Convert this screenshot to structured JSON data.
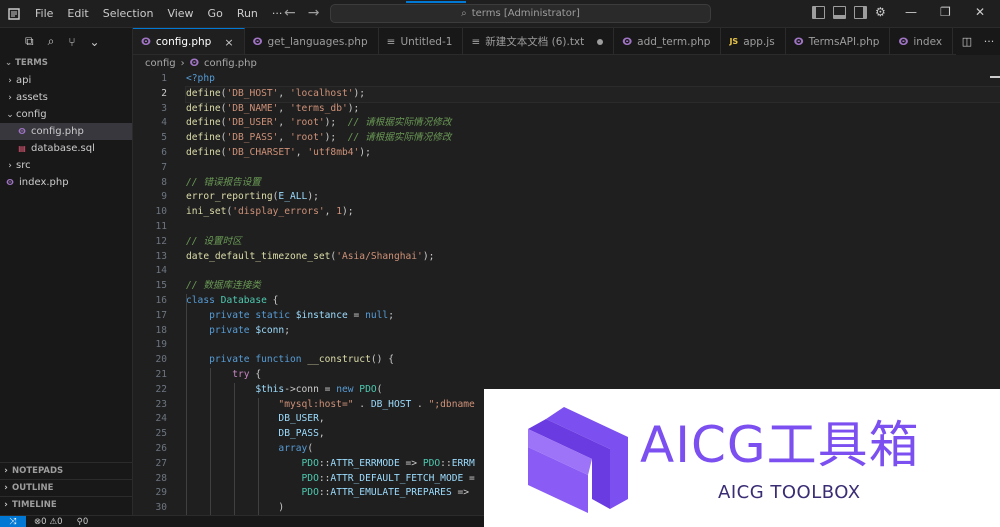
{
  "menu": [
    "File",
    "Edit",
    "Selection",
    "View",
    "Go",
    "Run",
    "···"
  ],
  "command_center": "terms [Administrator]",
  "sidebar": {
    "section": "TERMS",
    "tree": [
      {
        "name": "api",
        "type": "folder",
        "depth": 0
      },
      {
        "name": "assets",
        "type": "folder",
        "depth": 0
      },
      {
        "name": "config",
        "type": "folder-open",
        "depth": 0
      },
      {
        "name": "config.php",
        "type": "php",
        "depth": 1,
        "active": true
      },
      {
        "name": "database.sql",
        "type": "sql",
        "depth": 1
      },
      {
        "name": "src",
        "type": "folder",
        "depth": 0
      },
      {
        "name": "index.php",
        "type": "php",
        "depth": 0
      }
    ],
    "bottom": [
      "NOTEPADS",
      "OUTLINE",
      "TIMELINE"
    ]
  },
  "tabs": [
    {
      "label": "config.php",
      "active": true,
      "icon": "php",
      "close": "×"
    },
    {
      "label": "get_languages.php",
      "icon": "php"
    },
    {
      "label": "Untitled-1",
      "icon": "text"
    },
    {
      "label": "新建文本文档 (6).txt",
      "icon": "text",
      "dirty": true
    },
    {
      "label": "add_term.php",
      "icon": "php"
    },
    {
      "label": "app.js",
      "icon": "js"
    },
    {
      "label": "TermsAPI.php",
      "icon": "php"
    },
    {
      "label": "index",
      "icon": "php"
    }
  ],
  "breadcrumb": {
    "folder": "config",
    "file": "config.php"
  },
  "editor": {
    "current_line": 2,
    "lines": [
      "<?php",
      "define('DB_HOST', 'localhost');",
      "define('DB_NAME', 'terms_db');",
      "define('DB_USER', 'root');  // 请根据实际情况修改",
      "define('DB_PASS', 'root');  // 请根据实际情况修改",
      "define('DB_CHARSET', 'utf8mb4');",
      "",
      "// 错误报告设置",
      "error_reporting(E_ALL);",
      "ini_set('display_errors', 1);",
      "",
      "// 设置时区",
      "date_default_timezone_set('Asia/Shanghai');",
      "",
      "// 数据库连接类",
      "class Database {",
      "    private static $instance = null;",
      "    private $conn;",
      "",
      "    private function __construct() {",
      "        try {",
      "            $this->conn = new PDO(",
      "                \"mysql:host=\" . DB_HOST . \";dbname",
      "                DB_USER,",
      "                DB_PASS,",
      "                array(",
      "                    PDO::ATTR_ERRMODE => PDO::ERRM",
      "                    PDO::ATTR_DEFAULT_FETCH_MODE =",
      "                    PDO::ATTR_EMULATE_PREPARES =>",
      "                )"
    ]
  },
  "statusbar": {
    "errors": "0",
    "warnings": "0",
    "ports": "0"
  },
  "watermark": {
    "title": "AICG工具箱",
    "subtitle": "AICG TOOLBOX"
  },
  "colors": {
    "accent": "#0078d4",
    "brand": "#7b4ff0"
  }
}
